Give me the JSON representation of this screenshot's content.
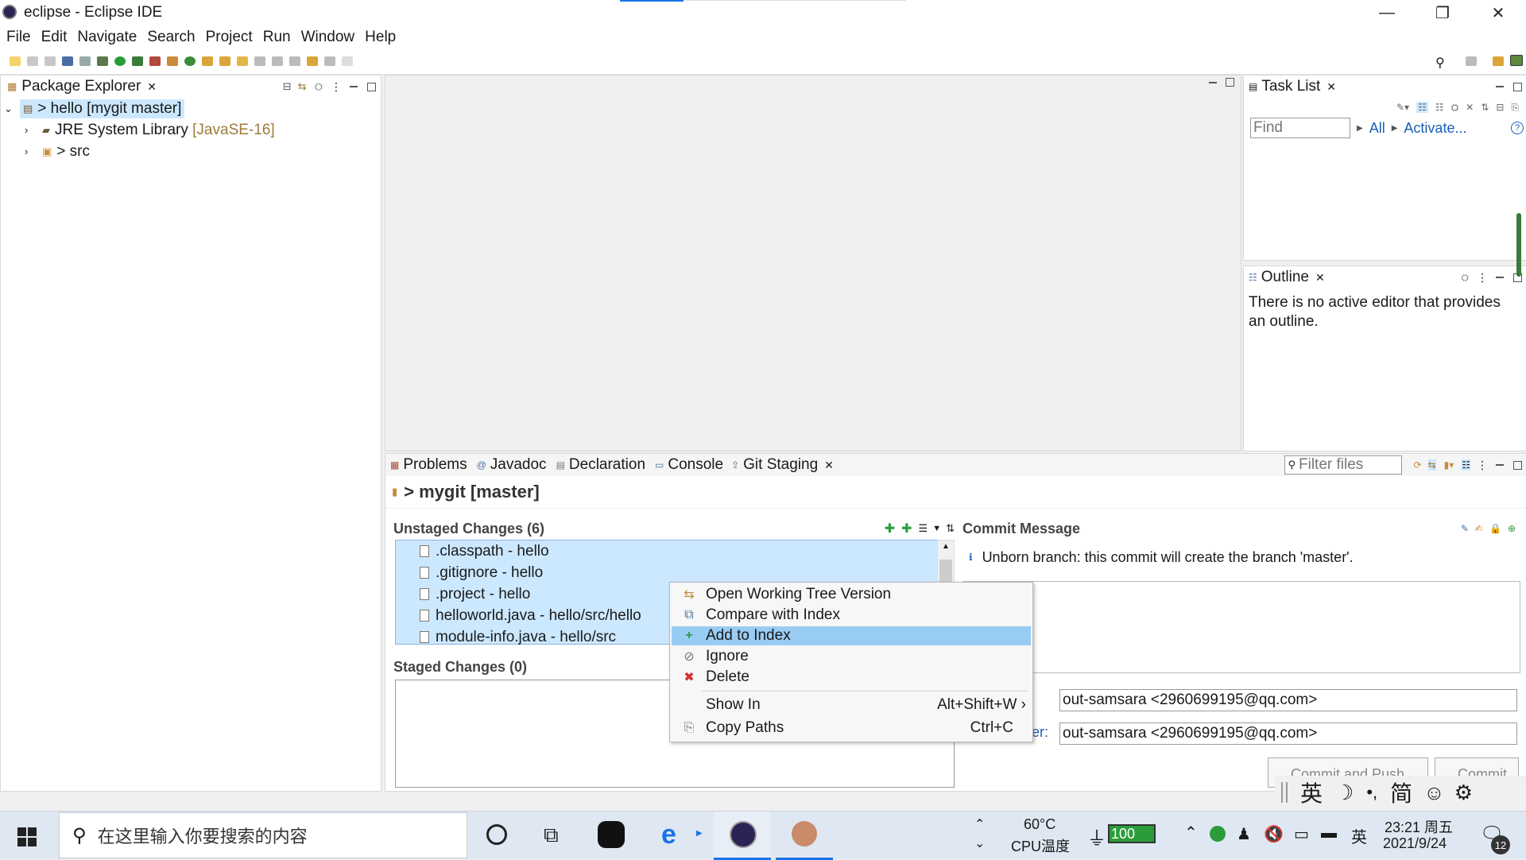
{
  "window": {
    "title": "eclipse - Eclipse IDE",
    "minimize": "—",
    "restore": "❐",
    "close": "✕"
  },
  "menu": [
    "File",
    "Edit",
    "Navigate",
    "Search",
    "Project",
    "Run",
    "Window",
    "Help"
  ],
  "package_explorer": {
    "tab": "Package Explorer",
    "tree": [
      {
        "label": "> hello [mygit master]",
        "decor": "",
        "selected": true
      },
      {
        "label": "JRE System Library",
        "decor": " [JavaSE-16]",
        "selected": false
      },
      {
        "label": "> src",
        "decor": "",
        "selected": false
      }
    ]
  },
  "task_list": {
    "tab": "Task List",
    "find_placeholder": "Find",
    "all": "All",
    "activate": "Activate...",
    "help": "?"
  },
  "outline": {
    "tab": "Outline",
    "message": "There is no active editor that provides an outline."
  },
  "bottom_tabs": [
    "Problems",
    "Javadoc",
    "Declaration",
    "Console",
    "Git Staging"
  ],
  "git_staging": {
    "filter_placeholder": "Filter files",
    "repo": "> mygit [master]",
    "unstaged_title": "Unstaged Changes (6)",
    "unstaged_files": [
      ".classpath - hello",
      ".gitignore - hello",
      ".project - hello",
      "helloworld.java - hello/src/hello",
      "module-info.java - hello/src"
    ],
    "staged_title": "Staged Changes (0)",
    "commit_title": "Commit Message",
    "commit_info": "Unborn branch: this commit will create the branch 'master'.",
    "author_value": "out-samsara <2960699195@qq.com>",
    "committer_label_partial": "ter:",
    "committer_value": "out-samsara <2960699195@qq.com>",
    "commit_push_btn": "Commit and Push...",
    "commit_btn": "Commit"
  },
  "context_menu": {
    "items": [
      {
        "label": "Open Working Tree Version",
        "accel": "",
        "icon": "⇆"
      },
      {
        "label": "Compare with Index",
        "accel": "",
        "icon": "⧉"
      },
      {
        "label": "Add to Index",
        "accel": "",
        "icon": "+",
        "highlighted": true
      },
      {
        "label": "Ignore",
        "accel": "",
        "icon": "⊘"
      },
      {
        "label": "Delete",
        "accel": "",
        "icon": "✖"
      },
      {
        "label": "Show In",
        "accel": "Alt+Shift+W ›",
        "icon": ""
      },
      {
        "label": "Copy Paths",
        "accel": "Ctrl+C",
        "icon": "⎘"
      }
    ]
  },
  "ime_bar": [
    "英",
    "☽",
    "•,",
    "简",
    "☺",
    "⚙"
  ],
  "taskbar": {
    "search_placeholder": "在这里输入你要搜索的内容",
    "temp": "60°C",
    "temp_label": "CPU温度",
    "battery": "100",
    "lang": "英",
    "time": "23:21 周五",
    "date": "2021/9/24",
    "notif_count": "12"
  },
  "colors": {
    "selection": "#cce8ff",
    "menu_highlight": "#99ccf3",
    "link": "#1a5fb4",
    "decor": "#a07a3a"
  }
}
